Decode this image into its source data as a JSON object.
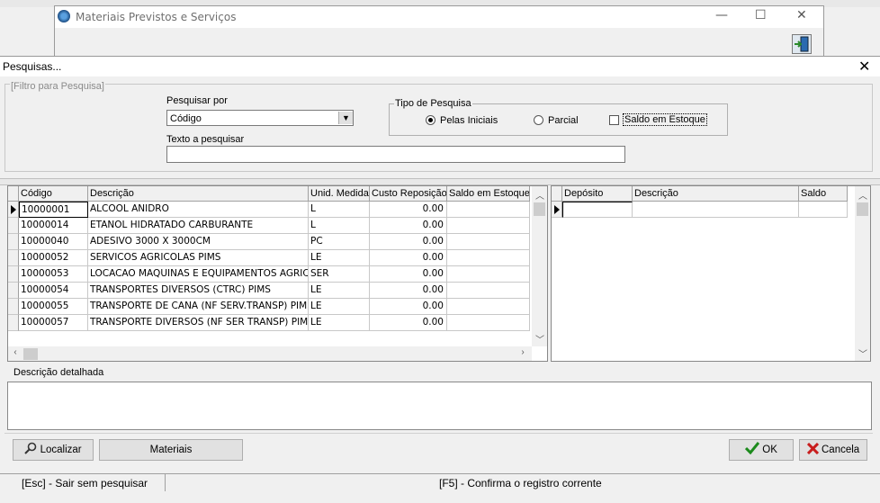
{
  "background_window": {
    "title": "Materiais Previstos e Serviços",
    "minimize": "—",
    "maximize": "☐",
    "close": "✕"
  },
  "dialog": {
    "title": "Pesquisas...",
    "close": "✕"
  },
  "filter": {
    "legend": "[Filtro para Pesquisa]",
    "pesquisar_por_label": "Pesquisar por",
    "pesquisar_por_value": "Código",
    "texto_label": "Texto a pesquisar",
    "texto_value": "",
    "tipo_legend": "Tipo de Pesquisa",
    "options": {
      "pelas_iniciais": "Pelas Iniciais",
      "parcial": "Parcial",
      "saldo_estoque": "Saldo em Estoque"
    },
    "selected": "pelas_iniciais",
    "saldo_checked": false
  },
  "grid_left": {
    "headers": [
      "Código",
      "Descrição",
      "Unid. Medida",
      "Custo Reposição",
      "Saldo em Estoque"
    ],
    "rows": [
      [
        "10000001",
        "ALCOOL ANIDRO",
        "L",
        "0.00",
        ""
      ],
      [
        "10000014",
        "ETANOL HIDRATADO CARBURANTE",
        "L",
        "0.00",
        ""
      ],
      [
        "10000040",
        "ADESIVO 3000 X 3000CM",
        "PC",
        "0.00",
        ""
      ],
      [
        "10000052",
        "SERVICOS AGRICOLAS PIMS",
        "LE",
        "0.00",
        ""
      ],
      [
        "10000053",
        "LOCACAO MAQUINAS E EQUIPAMENTOS AGRICOLAS",
        "SER",
        "0.00",
        ""
      ],
      [
        "10000054",
        "TRANSPORTES DIVERSOS (CTRC) PIMS",
        "LE",
        "0.00",
        ""
      ],
      [
        "10000055",
        "TRANSPORTE DE CANA (NF SERV.TRANSP) PIMS",
        "LE",
        "0.00",
        ""
      ],
      [
        "10000057",
        "TRANSPORTE DIVERSOS (NF SER TRANSP) PIMS",
        "LE",
        "0.00",
        ""
      ]
    ]
  },
  "grid_right": {
    "headers": [
      "Depósito",
      "Descrição",
      "Saldo"
    ]
  },
  "descricao_detalhada": {
    "label": "Descrição detalhada",
    "value": ""
  },
  "buttons": {
    "localizar": "Localizar",
    "materiais": "Materiais",
    "ok": "OK",
    "cancela": "Cancela"
  },
  "status": {
    "left": "[Esc] - Sair sem pesquisar",
    "right": "[F5] - Confirma o registro corrente"
  }
}
